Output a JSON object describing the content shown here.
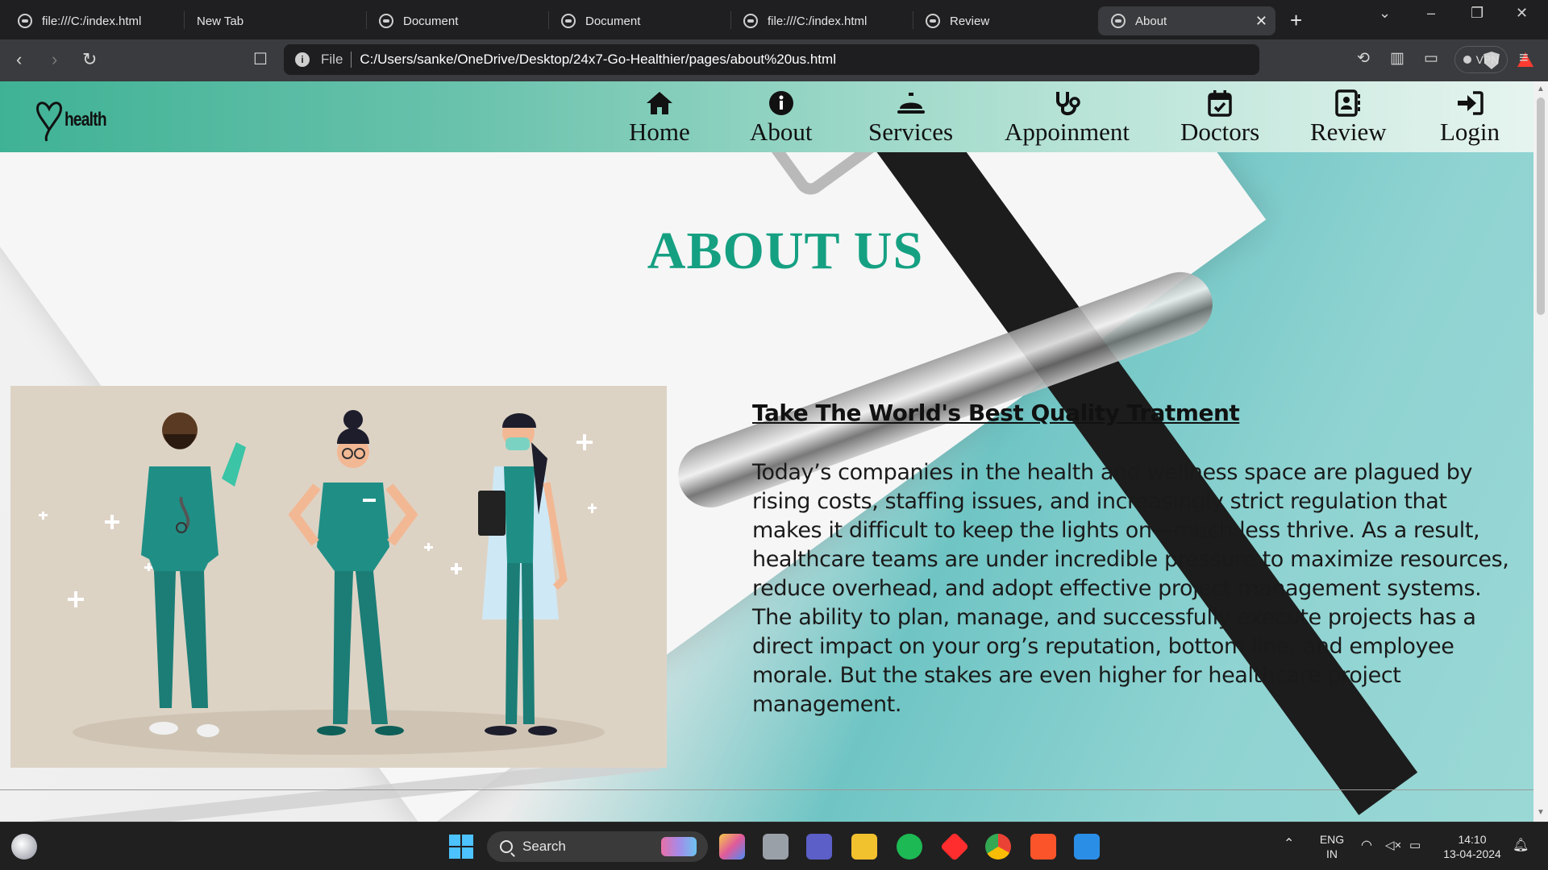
{
  "browser": {
    "tabs": [
      {
        "label": "file:///C:/index.html",
        "active": false
      },
      {
        "label": "New Tab",
        "active": false
      },
      {
        "label": "Document",
        "active": false
      },
      {
        "label": "Document",
        "active": false
      },
      {
        "label": "file:///C:/index.html",
        "active": false
      },
      {
        "label": "Review",
        "active": false
      },
      {
        "label": "About",
        "active": true
      }
    ],
    "address": {
      "scheme": "File",
      "url": "C:/Users/sanke/OneDrive/Desktop/24x7-Go-Healthier/pages/about%20us.html"
    },
    "vpn_label": "VPN"
  },
  "site": {
    "logo_text": "health",
    "nav": [
      {
        "label": "Home",
        "icon": "home-icon"
      },
      {
        "label": "About",
        "icon": "info-icon"
      },
      {
        "label": "Services",
        "icon": "bell-service-icon"
      },
      {
        "label": "Appoinment",
        "icon": "stethoscope-icon"
      },
      {
        "label": "Doctors",
        "icon": "calendar-check-icon"
      },
      {
        "label": "Review",
        "icon": "contact-card-icon"
      },
      {
        "label": "Login",
        "icon": "login-arrow-icon"
      }
    ],
    "page_title": "ABOUT US",
    "headline": "Take The World's Best Quality Tratment",
    "body": "Today’s companies in the health and wellness space are plagued by rising costs, staffing issues, and increasingly strict regulation that makes it difficult to keep the lights on—much less thrive. As a result, healthcare teams are under incredible pressure to maximize resources, reduce overhead, and adopt effective project management systems. The ability to plan, manage, and successfully execute projects has a direct impact on your org’s reputation, bottom line, and employee morale. But the stakes are even higher for healthcare project management.",
    "colors": {
      "title": "#15a082",
      "nav_gradient_start": "#3fb295",
      "nav_gradient_end": "#e6f4ef",
      "scrubs": "#1f8f86"
    }
  },
  "taskbar": {
    "search_placeholder": "Search",
    "language": "ENG",
    "region": "IN",
    "time": "14:10",
    "date": "13-04-2024"
  }
}
